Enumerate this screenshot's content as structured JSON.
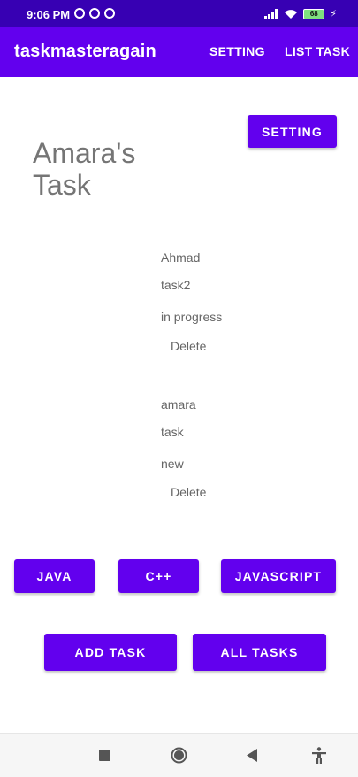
{
  "status_bar": {
    "time": "9:06 PM",
    "battery": "68"
  },
  "app_bar": {
    "title": "taskmasteragain",
    "actions": [
      "SETTING",
      "LIST TASK"
    ]
  },
  "main": {
    "setting_button": "SETTING",
    "heading": "Amara's Task",
    "tasks": [
      {
        "user": "Ahmad",
        "title": "task2",
        "state": "in progress",
        "delete_label": "Delete"
      },
      {
        "user": "amara",
        "title": "task",
        "state": "new",
        "delete_label": "Delete"
      }
    ],
    "language_buttons": [
      "JAVA",
      "C++",
      "JAVASCRIPT"
    ],
    "add_task_button": "ADD TASK",
    "all_tasks_button": "ALL TASKS"
  },
  "colors": {
    "status_bar": "#3700b3",
    "primary": "#6200ee"
  },
  "nav_icons": [
    "recent-apps-icon",
    "home-icon",
    "back-icon",
    "accessibility-icon"
  ]
}
